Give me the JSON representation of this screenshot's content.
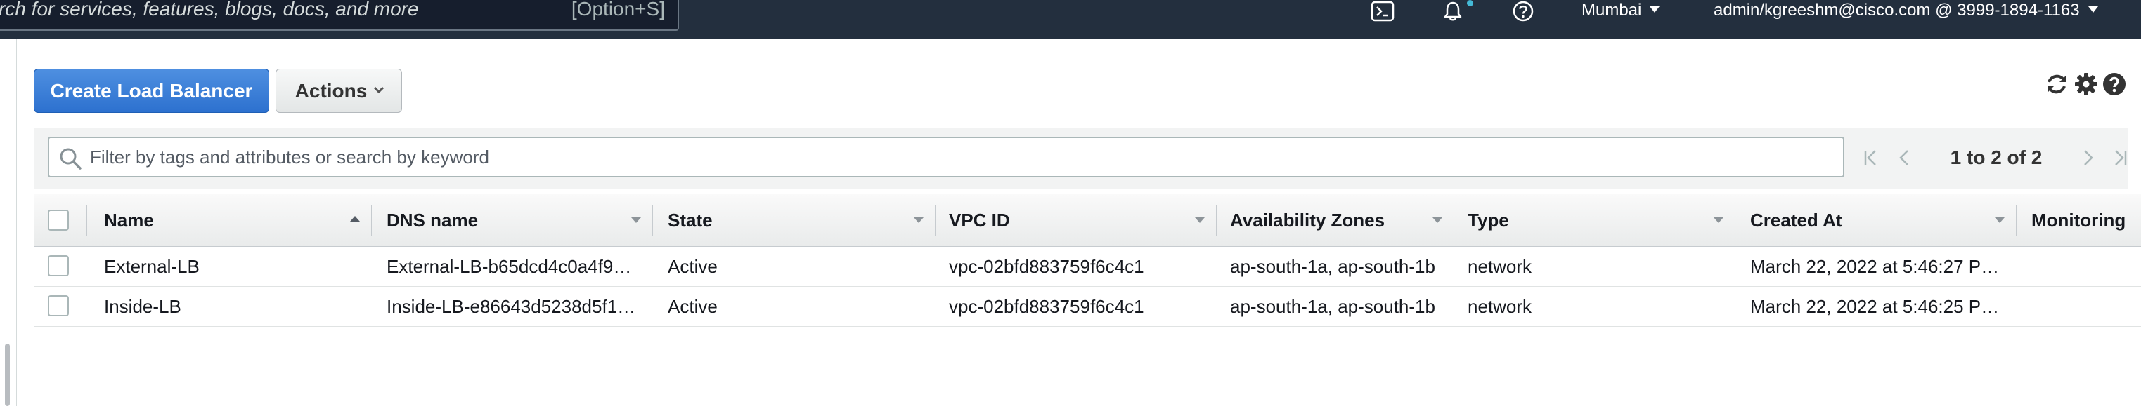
{
  "topbar": {
    "search_placeholder": "rch for services, features, blogs, docs, and more",
    "search_shortcut": "[Option+S]",
    "icons": [
      "cloudshell-icon",
      "bell-icon",
      "help-icon"
    ],
    "region": "Mumbai",
    "account": "admin/kgreeshm@cisco.com @ 3999-1894-1163"
  },
  "toolbar": {
    "create_label": "Create Load Balancer",
    "actions_label": "Actions",
    "icons": [
      "refresh-icon",
      "settings-icon",
      "help-icon"
    ]
  },
  "filter": {
    "placeholder": "Filter by tags and attributes or search by keyword",
    "value": ""
  },
  "pagination": {
    "label": "1 to 2 of 2"
  },
  "table": {
    "columns": [
      "Name",
      "DNS name",
      "State",
      "VPC ID",
      "Availability Zones",
      "Type",
      "Created At",
      "Monitoring"
    ],
    "sorted_column": "Name",
    "sort_direction": "ascending",
    "rows": [
      {
        "name": "External-LB",
        "dns": "External-LB-b65dcd4c0a4f9…",
        "state": "Active",
        "vpc": "vpc-02bfd883759f6c4c1",
        "zones": "ap-south-1a, ap-south-1b",
        "type": "network",
        "created": "March 22, 2022 at 5:46:27 P…",
        "monitoring": ""
      },
      {
        "name": "Inside-LB",
        "dns": "Inside-LB-e86643d5238d5f1…",
        "state": "Active",
        "vpc": "vpc-02bfd883759f6c4c1",
        "zones": "ap-south-1a, ap-south-1b",
        "type": "network",
        "created": "March 22, 2022 at 5:46:25 P…",
        "monitoring": ""
      }
    ]
  },
  "colors": {
    "topbar_bg": "#232f3e",
    "primary_button": "#2d71cf",
    "notification_dot": "#44b9d6"
  }
}
